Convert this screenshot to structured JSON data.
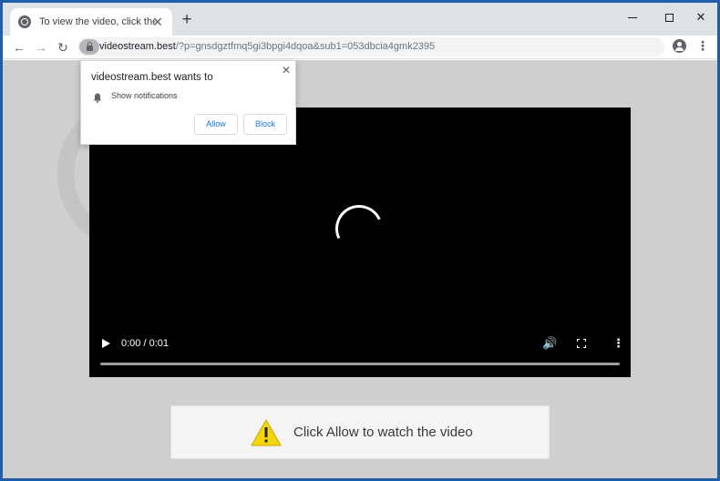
{
  "browser": {
    "tab_title": "To view the video, click the Allow",
    "tab_close": "✕",
    "new_tab": "+",
    "url_host": "videostream.best",
    "url_path": "/?p=gnsdgztfmq5gi3bpgi4dqoa&sub1=053dbcia4gmk2395",
    "back_icon": "←",
    "forward_icon": "→",
    "reload_icon": "↻",
    "star_icon": "☆",
    "menu_icon": "⋮",
    "close_icon": "✕"
  },
  "popup": {
    "title": "videostream.best wants to",
    "permission": "Show notifications",
    "allow_label": "Allow",
    "block_label": "Block",
    "close_icon": "✕"
  },
  "video": {
    "time": "0:00 / 0:01",
    "progress": 0,
    "volume_icon": "🔊",
    "more_icon": "⋮"
  },
  "notice": {
    "text": "Click Allow to watch the video"
  },
  "colors": {
    "accent": "#1a73e8",
    "warning": "#f5d60a",
    "frame": "#1f5fa8"
  }
}
